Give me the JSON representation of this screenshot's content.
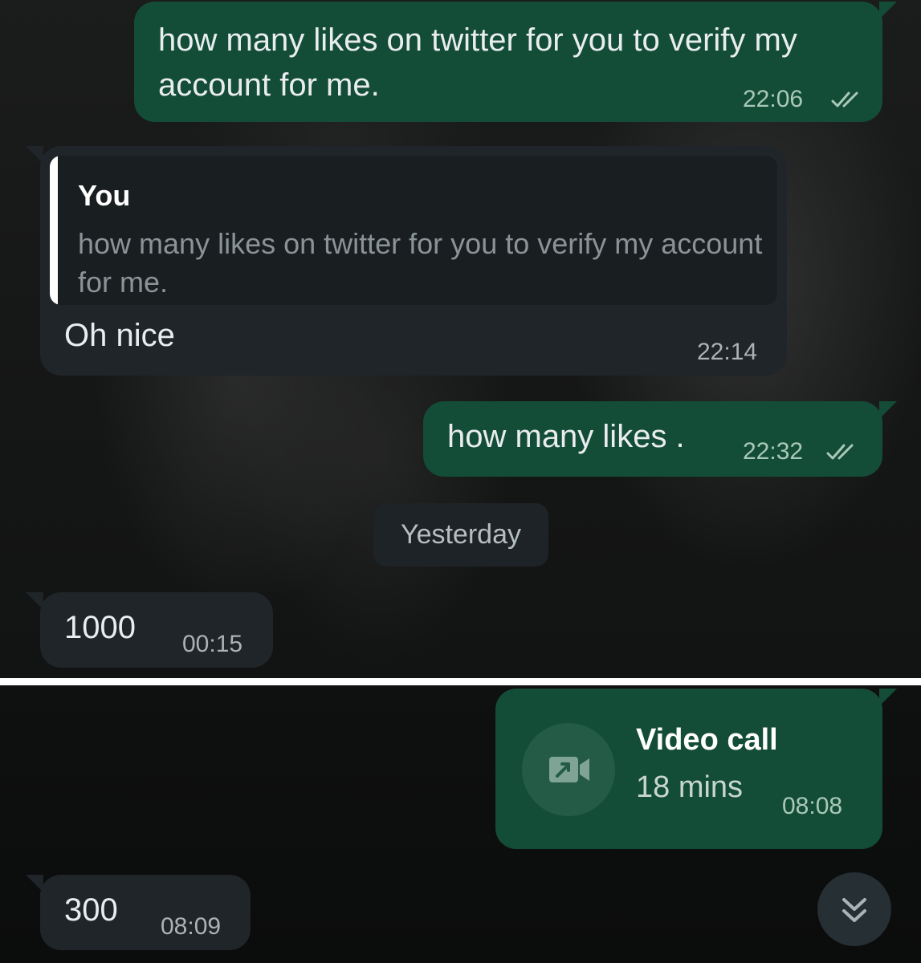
{
  "messages": [
    {
      "text": "how many likes on twitter for you to verify my account for me.",
      "time": "22:06",
      "status": "read"
    },
    {
      "quote_author": "You",
      "quote_text": "how many likes on twitter for you to verify my account for me.",
      "text": "Oh nice",
      "time": "22:14"
    },
    {
      "text": "how many likes .",
      "time": "22:32",
      "status": "read"
    },
    {
      "text": "1000",
      "time": "00:15"
    },
    {
      "call_title": "Video call",
      "call_duration": "18 mins",
      "time": "08:08",
      "icon": "video-call-icon"
    },
    {
      "text": "300",
      "time": "08:09"
    }
  ],
  "date_separator": "Yesterday",
  "scroll_button_icon": "double-chevron-down-icon",
  "colors": {
    "outgoing_bubble": "#144d37",
    "incoming_bubble": "#1f2528",
    "text": "#e9edef",
    "timestamp": "#aab3b6"
  }
}
